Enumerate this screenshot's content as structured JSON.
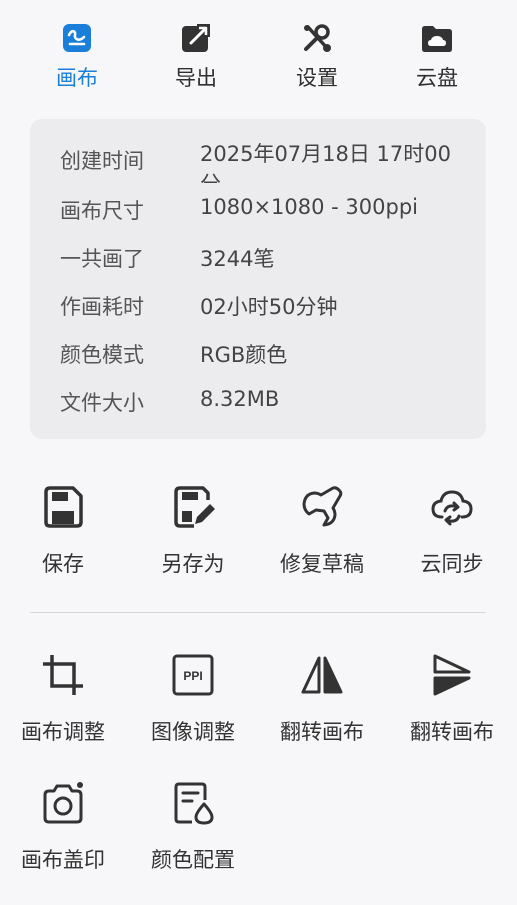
{
  "tabs": [
    {
      "label": "画布",
      "icon": "canvas-icon",
      "active": true
    },
    {
      "label": "导出",
      "icon": "export-icon",
      "active": false
    },
    {
      "label": "设置",
      "icon": "tools-icon",
      "active": false
    },
    {
      "label": "云盘",
      "icon": "cloud-drive-icon",
      "active": false
    }
  ],
  "info": {
    "created_label": "创建时间",
    "created_value": "2025年07月18日 17时00分",
    "size_label": "画布尺寸",
    "size_value": "1080×1080 - 300ppi",
    "strokes_label": "一共画了",
    "strokes_value": "3244笔",
    "time_label": "作画耗时",
    "time_value": "02小时50分钟",
    "color_label": "颜色模式",
    "color_value": "RGB颜色",
    "file_label": "文件大小",
    "file_value": "8.32MB"
  },
  "actions_row1": [
    {
      "label": "保存",
      "icon": "save-icon"
    },
    {
      "label": "另存为",
      "icon": "save-as-icon"
    },
    {
      "label": "修复草稿",
      "icon": "wrench-icon"
    },
    {
      "label": "云同步",
      "icon": "cloud-sync-icon"
    }
  ],
  "actions_row2": [
    {
      "label": "画布调整",
      "icon": "crop-icon"
    },
    {
      "label": "图像调整",
      "icon": "ppi-icon"
    },
    {
      "label": "翻转画布",
      "icon": "flip-horizontal-icon"
    },
    {
      "label": "翻转画布",
      "icon": "flip-vertical-icon"
    }
  ],
  "actions_row3": [
    {
      "label": "画布盖印",
      "icon": "camera-icon"
    },
    {
      "label": "颜色配置",
      "icon": "color-profile-icon"
    }
  ],
  "colors": {
    "accent": "#1a7fd9",
    "icon": "#2f2f2f",
    "card": "#ececef",
    "background": "#f7f7f9"
  }
}
